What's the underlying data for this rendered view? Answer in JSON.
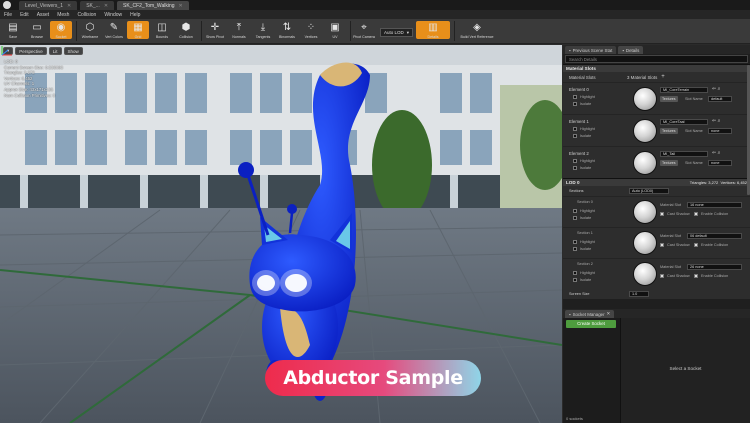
{
  "window": {
    "tabs": [
      {
        "label": "Level_Viewers_1"
      },
      {
        "label": "SK_..."
      },
      {
        "label": "SK_CF2_Tom_Walking"
      }
    ]
  },
  "menu": [
    "File",
    "Edit",
    "Asset",
    "Mesh",
    "Collision",
    "Window",
    "Help"
  ],
  "toolbar": {
    "buttons": [
      {
        "label": "Save",
        "icon": "save-icon"
      },
      {
        "label": "Browse",
        "icon": "browse-icon"
      },
      {
        "label": "Socket",
        "icon": "socket-icon",
        "active": true
      },
      {
        "label": "Wireframe",
        "icon": "wireframe-icon"
      },
      {
        "label": "Vert Colors",
        "icon": "vert-colors-icon"
      },
      {
        "label": "Grid",
        "icon": "grid-icon"
      },
      {
        "label": "Bounds",
        "icon": "bounds-icon"
      },
      {
        "label": "Collision",
        "icon": "collision-icon"
      },
      {
        "label": "Show Pivot",
        "icon": "show-pivot-icon"
      },
      {
        "label": "Normals",
        "icon": "normals-icon"
      },
      {
        "label": "Tangents",
        "icon": "tangents-icon"
      },
      {
        "label": "Binormals",
        "icon": "binormals-icon"
      },
      {
        "label": "Vertices",
        "icon": "vertices-icon"
      },
      {
        "label": "UV",
        "icon": "uv-icon"
      },
      {
        "label": "Pivot Camera",
        "icon": "camera-icon"
      }
    ],
    "lod_select": "Auto LOD",
    "extra_buttons": [
      {
        "label": "Details",
        "icon": "details-icon"
      },
      {
        "label": "Build Vert Reference",
        "icon": "build-icon"
      }
    ]
  },
  "viewport": {
    "buttons": [
      "Perspective",
      "Lit",
      "Show"
    ],
    "stats": [
      "LOD: 0",
      "Current Screen Size: 0.533093",
      "Triangles: 3,272",
      "Vertices: 6,452",
      "UV Channels: 1",
      "Approx Size: 43x171x126",
      "Num Collision Primitives: 0"
    ],
    "banner": "Abductor Sample"
  },
  "panel": {
    "tabs": [
      "Previous Scene Stat",
      "Details"
    ],
    "search_placeholder": "Search Details",
    "material_slots": {
      "title": "Material Slots",
      "label": "Material Slots",
      "count": "3 Material Slots",
      "elements": [
        {
          "name": "Element 0",
          "material": "MI_CoreTerrain",
          "slot_name": "default"
        },
        {
          "name": "Element 1",
          "material": "MI_CoreTaal",
          "slot_name": "none"
        },
        {
          "name": "Element 2",
          "material": "MI_Tail",
          "slot_name": "none"
        }
      ],
      "highlight": "Highlight",
      "isolate": "Isolate",
      "textures": "Textures",
      "slot_name_label": "Slot Name"
    },
    "lod0": {
      "title": "LOD 0",
      "triangles": "Triangles: 3,272",
      "vertices": "Vertices: 6,452",
      "sections_label": "Sections",
      "sections_value": "Auto (LOD0)",
      "sections": [
        {
          "name": "Section 0",
          "material_slot": "16 none"
        },
        {
          "name": "Section 1",
          "material_slot": "06 default"
        },
        {
          "name": "Section 2",
          "material_slot": "26 none"
        }
      ],
      "material_slot_label": "Material Slot",
      "cast_shadow": "Cast Shadow",
      "enable_collision": "Enable Collision",
      "screen_size_label": "Screen Size",
      "screen_size_value": "1.0"
    },
    "socket_manager": {
      "tab": "Socket Manager",
      "create_button": "Create Socket",
      "count": "0 sockets",
      "select_text": "Select a Socket"
    }
  }
}
